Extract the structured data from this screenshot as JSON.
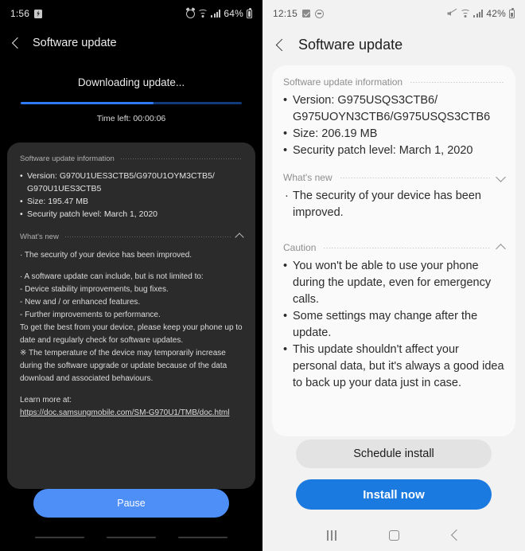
{
  "left_screen": {
    "theme": "dark",
    "status_bar": {
      "time": "1:56",
      "battery_percent": "64%",
      "icons": [
        "bolt-badge-icon",
        "alarm-icon",
        "wifi-icon",
        "signal-icon",
        "battery-icon"
      ]
    },
    "app_bar": {
      "back_icon": "chevron-left-icon",
      "title": "Software update"
    },
    "download": {
      "title": "Downloading update...",
      "progress_percent": 60,
      "time_left_label": "Time left: 00:00:06"
    },
    "info_section": {
      "heading": "Software update information",
      "items": [
        "Version: G970U1UES3CTB5/G970U1OYM3CTB5/",
        "G970U1UES3CTB5",
        "Size: 195.47 MB",
        "Security patch level: March 1, 2020"
      ]
    },
    "whats_new": {
      "heading": "What's new",
      "chevron": "chevron-up-icon",
      "paragraphs": [
        "· The security of your device has been improved.",
        "· A software update can include, but is not limited to:\n - Device stability improvements, bug fixes.\n - New and / or enhanced features.\n - Further improvements to performance.\nTo get the best from your device, please keep your phone up to date and regularly check for software updates.\n※ The temperature of the device may temporarily increase during the software upgrade or update because of the data download and associated behaviours.",
        "Learn more at:"
      ],
      "link": "https://doc.samsungmobile.com/SM-G970U1/TMB/doc.html"
    },
    "pause_button": "Pause"
  },
  "right_screen": {
    "theme": "light",
    "status_bar": {
      "time": "12:15",
      "battery_percent": "42%",
      "icons": [
        "check-square-icon",
        "do-not-disturb-icon",
        "mute-icon",
        "wifi-icon",
        "signal-icon",
        "battery-icon"
      ]
    },
    "app_bar": {
      "back_icon": "chevron-left-icon",
      "title": "Software update"
    },
    "info_section": {
      "heading": "Software update information",
      "items": [
        "Version: G975USQS3CTB6/",
        "G975UOYN3CTB6/G975USQS3CTB6",
        "Size: 206.19 MB",
        "Security patch level: March 1, 2020"
      ]
    },
    "whats_new": {
      "heading": "What's new",
      "chevron": "chevron-down-icon",
      "body": "The security of your device has been improved."
    },
    "caution": {
      "heading": "Caution",
      "chevron": "chevron-up-icon",
      "items": [
        "You won't be able to use your phone during the update, even for emergency calls.",
        "Some settings may change after the update.",
        "This update shouldn't affect your personal data, but it's always a good idea to back up your data just in case."
      ]
    },
    "schedule_button": "Schedule install",
    "install_button": "Install now",
    "nav_bar": [
      "recents-icon",
      "home-icon",
      "back-icon"
    ]
  },
  "colors": {
    "accent_blue": "#1a7ae0",
    "pause_blue": "#4d8ef7",
    "progress_blue": "#2f7af5",
    "dark_card": "#2b2b2b",
    "light_card": "#fafafa",
    "light_bg": "#f2f2f2"
  }
}
